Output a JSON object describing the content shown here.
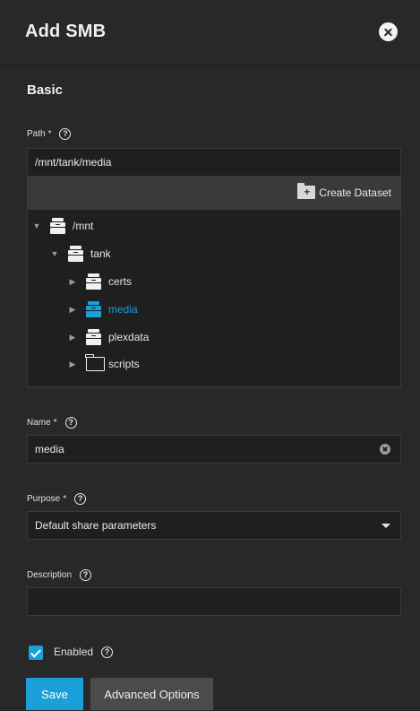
{
  "header": {
    "title": "Add SMB"
  },
  "section": {
    "title": "Basic"
  },
  "path": {
    "label": "Path",
    "required_mark": "*",
    "help": "?",
    "value": "/mnt/tank/media",
    "toolbar": {
      "create_dataset_label": "Create Dataset"
    },
    "tree": [
      {
        "label": "/mnt",
        "icon": "dataset-icon",
        "expanded": true
      },
      {
        "label": "tank",
        "icon": "dataset-icon",
        "expanded": true
      },
      {
        "label": "certs",
        "icon": "dataset-icon",
        "expanded": false
      },
      {
        "label": "media",
        "icon": "dataset-icon",
        "expanded": false,
        "selected": true
      },
      {
        "label": "plexdata",
        "icon": "dataset-icon",
        "expanded": false
      },
      {
        "label": "scripts",
        "icon": "folder-icon",
        "expanded": false
      }
    ]
  },
  "name": {
    "label": "Name",
    "required_mark": "*",
    "help": "?",
    "value": "media"
  },
  "purpose": {
    "label": "Purpose",
    "required_mark": "*",
    "help": "?",
    "value": "Default share parameters"
  },
  "description": {
    "label": "Description",
    "help": "?",
    "value": ""
  },
  "enabled": {
    "label": "Enabled",
    "help": "?",
    "checked": true
  },
  "buttons": {
    "save": "Save",
    "advanced": "Advanced Options"
  },
  "colors": {
    "accent": "#1a9fd9",
    "background": "#282828",
    "input_bg": "#1f1f1f"
  }
}
